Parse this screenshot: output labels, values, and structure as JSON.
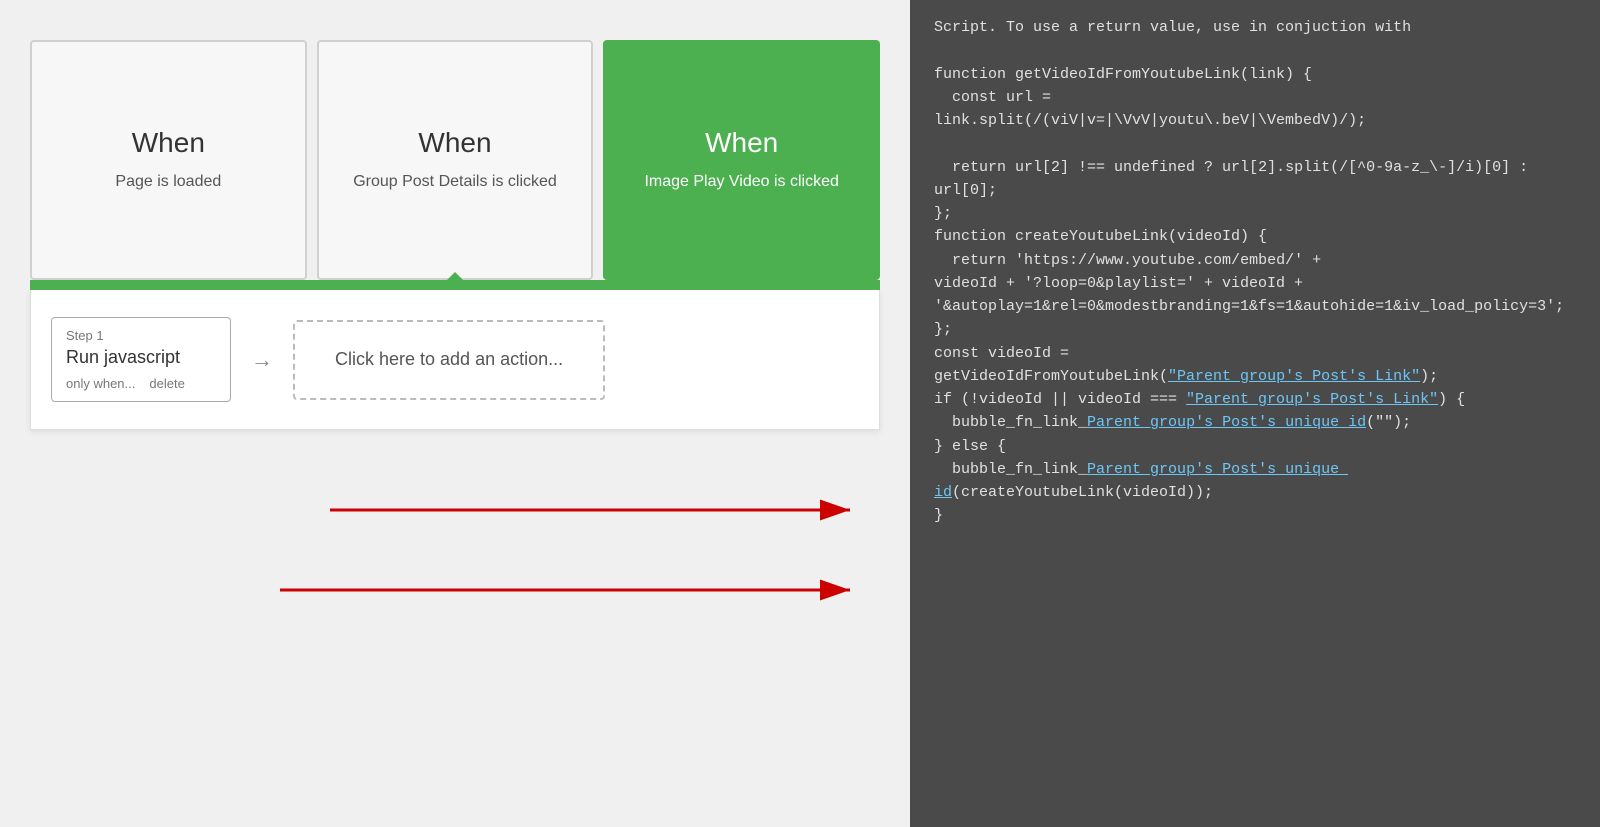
{
  "left": {
    "cards": [
      {
        "id": "card-page-loaded",
        "title": "When",
        "subtitle": "Page is loaded",
        "active": false
      },
      {
        "id": "card-group-post",
        "title": "When",
        "subtitle": "Group Post Details is clicked",
        "active": false
      },
      {
        "id": "card-image-play",
        "title": "When",
        "subtitle": "Image Play Video is clicked",
        "active": true
      }
    ],
    "step": {
      "label": "Step 1",
      "name": "Run javascript",
      "actions": [
        "only when...",
        "delete"
      ]
    },
    "add_action_label": "Click here to add an action..."
  },
  "right": {
    "intro": "Script. To use a return value, use in conjuction with",
    "code_blocks": [
      "function getVideoIdFromYoutubeLink(link) {",
      "  const url =",
      "link.split(/(vi\\/|v=|\\VvV|youtu\\.be\\/|\\Vembed\\/)/);",
      "  return url[2] !== undefined ? url[2].split(/[^0-9a-z_\\-]/i)[0] : url[0];",
      "};",
      "function createYoutubeLink(videoId) {",
      "  return 'https://www.youtube.com/embed/' +",
      "videoId + '?loop=0&playlist=' + videoId +",
      "'&autoplay=1&rel=0&modestbranding=1&fs=1&autohide=1&iv_load_policy=3';",
      "};",
      "const videoId =",
      "getVideoIdFromYoutubeLink(",
      "BLUE:Parent group's Post's Link",
      ");",
      "if (!videoId || videoId === ",
      "BLUE:Parent group's Post's Link",
      ") {",
      "  bubble_fn_link_BLUE:Parent group's Post's unique id(\"\");",
      "} else {",
      "  bubble_fn_link_BLUE:Parent group's Post's unique id(createYoutubeLink(videoId));",
      "}"
    ]
  }
}
